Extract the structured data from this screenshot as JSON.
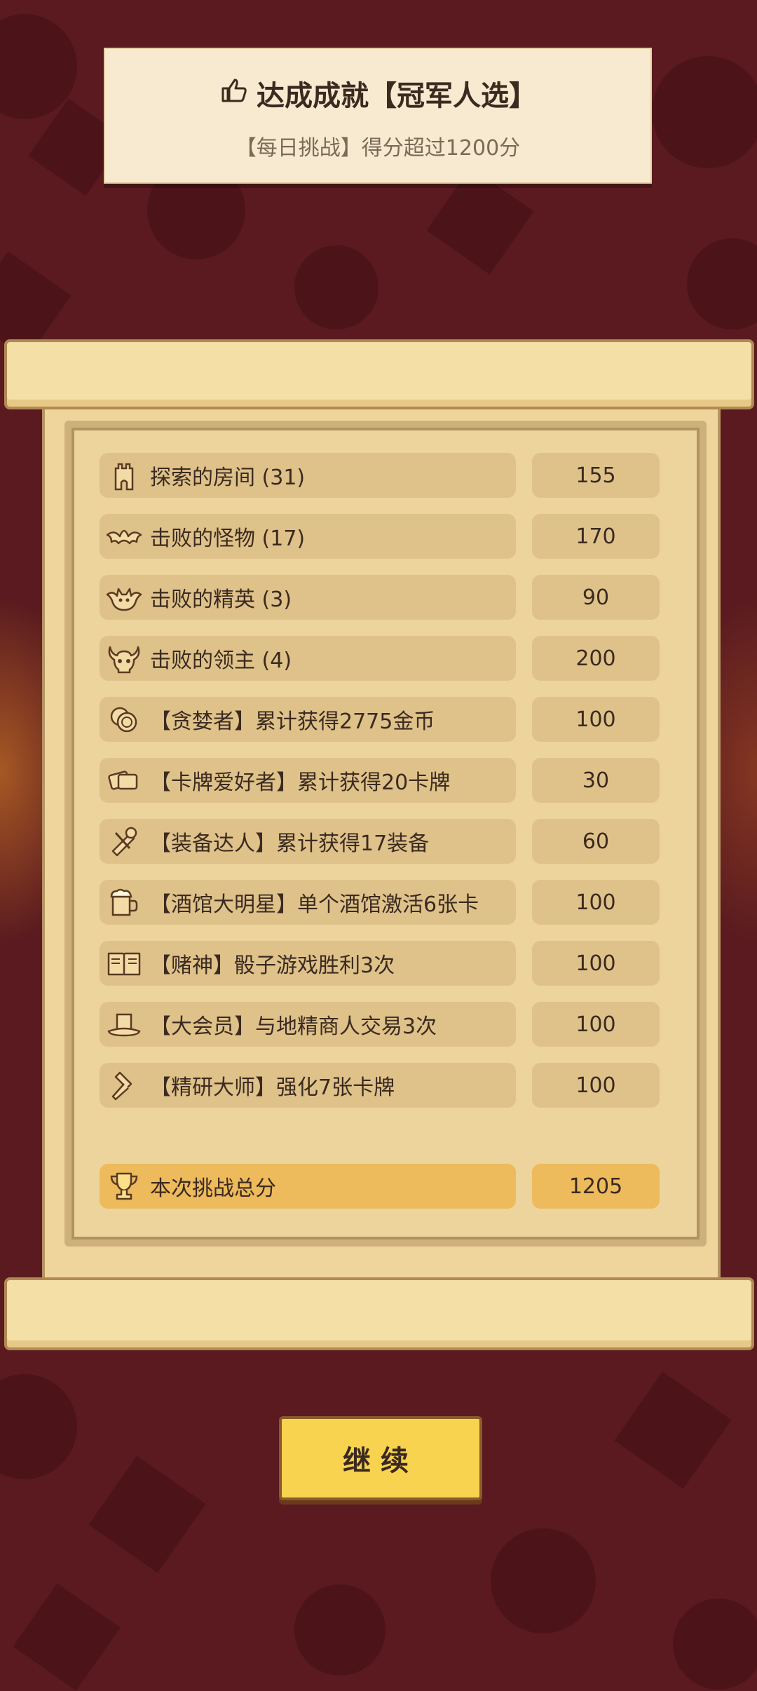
{
  "banner": {
    "title": "达成成就【冠军人选】",
    "subtitle": "【每日挑战】得分超过1200分"
  },
  "rows": [
    {
      "icon": "tower-icon",
      "label": "探索的房间 (31)",
      "score": "155"
    },
    {
      "icon": "bat-icon",
      "label": "击败的怪物 (17)",
      "score": "170"
    },
    {
      "icon": "devil-icon",
      "label": "击败的精英 (3)",
      "score": "90"
    },
    {
      "icon": "horned-skull-icon",
      "label": "击败的领主 (4)",
      "score": "200"
    },
    {
      "icon": "coins-icon",
      "label": "【贪婪者】累计获得2775金币",
      "score": "100"
    },
    {
      "icon": "cards-icon",
      "label": "【卡牌爱好者】累计获得20卡牌",
      "score": "30"
    },
    {
      "icon": "equipment-icon",
      "label": "【装备达人】累计获得17装备",
      "score": "60"
    },
    {
      "icon": "beer-mug-icon",
      "label": "【酒馆大明星】单个酒馆激活6张卡",
      "score": "100"
    },
    {
      "icon": "book-icon",
      "label": "【赌神】骰子游戏胜利3次",
      "score": "100"
    },
    {
      "icon": "top-hat-icon",
      "label": "【大会员】与地精商人交易3次",
      "score": "100"
    },
    {
      "icon": "hammer-icon",
      "label": "【精研大师】强化7张卡牌",
      "score": "100"
    }
  ],
  "total": {
    "icon": "trophy-icon",
    "label": "本次挑战总分",
    "score": "1205"
  },
  "continue_label": "继续",
  "colors": {
    "background": "#5a1a1f",
    "parchment": "#efd59c",
    "pill": "#dfc28a",
    "highlight": "#edba5c",
    "button": "#f7d34f"
  }
}
